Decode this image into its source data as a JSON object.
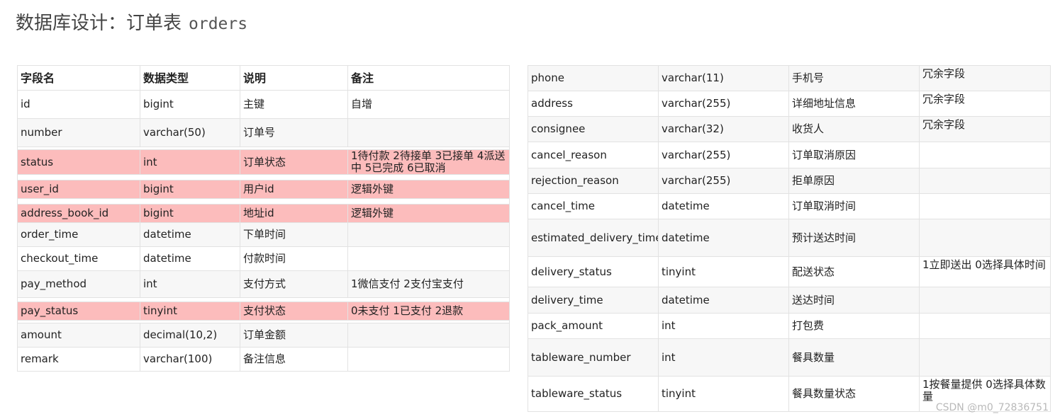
{
  "title": {
    "text": "数据库设计：订单表",
    "code": "orders"
  },
  "left_table": {
    "headers": [
      "字段名",
      "数据类型",
      "说明",
      "备注"
    ],
    "rows": [
      {
        "field": "id",
        "type": "bigint",
        "desc": "主键",
        "note": "自增",
        "highlight": false
      },
      {
        "field": "number",
        "type": "varchar(50)",
        "desc": "订单号",
        "note": "",
        "highlight": false
      },
      {
        "field": "status",
        "type": "int",
        "desc": "订单状态",
        "note": "1待付款 2待接单 3已接单 4派送中 5已完成 6已取消",
        "highlight": true
      },
      {
        "field": "user_id",
        "type": "bigint",
        "desc": "用户id",
        "note": "逻辑外键",
        "highlight": true
      },
      {
        "field": "address_book_id",
        "type": "bigint",
        "desc": "地址id",
        "note": "逻辑外键",
        "highlight": true
      },
      {
        "field": "order_time",
        "type": "datetime",
        "desc": "下单时间",
        "note": "",
        "highlight": false
      },
      {
        "field": "checkout_time",
        "type": "datetime",
        "desc": "付款时间",
        "note": "",
        "highlight": false
      },
      {
        "field": "pay_method",
        "type": "int",
        "desc": "支付方式",
        "note": "1微信支付 2支付宝支付",
        "highlight": false
      },
      {
        "field": "pay_status",
        "type": "tinyint",
        "desc": "支付状态",
        "note": "0未支付 1已支付 2退款",
        "highlight": true
      },
      {
        "field": "amount",
        "type": "decimal(10,2)",
        "desc": "订单金额",
        "note": "",
        "highlight": false
      },
      {
        "field": "remark",
        "type": "varchar(100)",
        "desc": "备注信息",
        "note": "",
        "highlight": false
      }
    ]
  },
  "right_table": {
    "rows": [
      {
        "field": "phone",
        "type": "varchar(11)",
        "desc": "手机号",
        "note": "冗余字段"
      },
      {
        "field": "address",
        "type": "varchar(255)",
        "desc": "详细地址信息",
        "note": "冗余字段"
      },
      {
        "field": "consignee",
        "type": "varchar(32)",
        "desc": "收货人",
        "note": "冗余字段"
      },
      {
        "field": "cancel_reason",
        "type": "varchar(255)",
        "desc": "订单取消原因",
        "note": ""
      },
      {
        "field": "rejection_reason",
        "type": "varchar(255)",
        "desc": "拒单原因",
        "note": ""
      },
      {
        "field": "cancel_time",
        "type": "datetime",
        "desc": "订单取消时间",
        "note": ""
      },
      {
        "field": "estimated_delivery_time",
        "type": "datetime",
        "desc": "预计送达时间",
        "note": ""
      },
      {
        "field": "delivery_status",
        "type": "tinyint",
        "desc": "配送状态",
        "note": "1立即送出 0选择具体时间"
      },
      {
        "field": "delivery_time",
        "type": "datetime",
        "desc": "送达时间",
        "note": ""
      },
      {
        "field": "pack_amount",
        "type": "int",
        "desc": "打包费",
        "note": ""
      },
      {
        "field": "tableware_number",
        "type": "int",
        "desc": "餐具数量",
        "note": ""
      },
      {
        "field": "tableware_status",
        "type": "tinyint",
        "desc": "餐具数量状态",
        "note": "1按餐量提供 0选择具体数量"
      }
    ]
  },
  "watermark": "CSDN @m0_72836751",
  "colors": {
    "highlight": "#fcbcbc",
    "stripe": "#f7f7f7",
    "border": "#e2e2e2"
  }
}
